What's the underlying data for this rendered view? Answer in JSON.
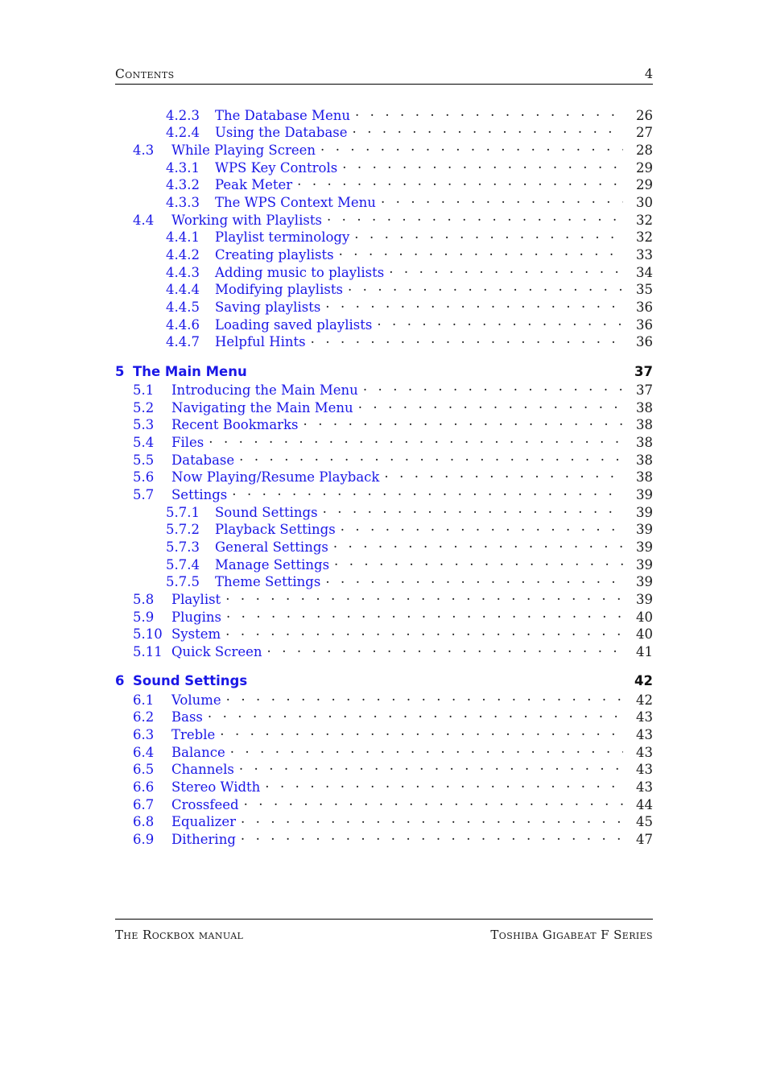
{
  "header": {
    "title": "Contents",
    "page_number": "4"
  },
  "footer": {
    "left": "The Rockbox manual",
    "right": "Toshiba Gigabeat F Series"
  },
  "colors": {
    "link": "#1a17e6",
    "text": "#1a1a1a",
    "leader": "#222222"
  },
  "toc": {
    "entries": [
      {
        "level": 3,
        "number": "4.2.3",
        "title": "The Database Menu",
        "page": "26"
      },
      {
        "level": 3,
        "number": "4.2.4",
        "title": "Using the Database",
        "page": "27"
      },
      {
        "level": 2,
        "number": "4.3",
        "title": "While Playing Screen",
        "page": "28"
      },
      {
        "level": 3,
        "number": "4.3.1",
        "title": "WPS Key Controls",
        "page": "29"
      },
      {
        "level": 3,
        "number": "4.3.2",
        "title": "Peak Meter",
        "page": "29"
      },
      {
        "level": 3,
        "number": "4.3.3",
        "title": "The WPS Context Menu",
        "page": "30"
      },
      {
        "level": 2,
        "number": "4.4",
        "title": "Working with Playlists",
        "page": "32"
      },
      {
        "level": 3,
        "number": "4.4.1",
        "title": "Playlist terminology",
        "page": "32"
      },
      {
        "level": 3,
        "number": "4.4.2",
        "title": "Creating playlists",
        "page": "33"
      },
      {
        "level": 3,
        "number": "4.4.3",
        "title": "Adding music to playlists",
        "page": "34"
      },
      {
        "level": 3,
        "number": "4.4.4",
        "title": "Modifying playlists",
        "page": "35"
      },
      {
        "level": 3,
        "number": "4.4.5",
        "title": "Saving playlists",
        "page": "36"
      },
      {
        "level": 3,
        "number": "4.4.6",
        "title": "Loading saved playlists",
        "page": "36"
      },
      {
        "level": 3,
        "number": "4.4.7",
        "title": "Helpful Hints",
        "page": "36"
      },
      {
        "level": 1,
        "number": "5",
        "title": "The Main Menu",
        "page": "37"
      },
      {
        "level": 2,
        "number": "5.1",
        "title": "Introducing the Main Menu",
        "page": "37"
      },
      {
        "level": 2,
        "number": "5.2",
        "title": "Navigating the Main Menu",
        "page": "38"
      },
      {
        "level": 2,
        "number": "5.3",
        "title": "Recent Bookmarks",
        "page": "38"
      },
      {
        "level": 2,
        "number": "5.4",
        "title": "Files",
        "page": "38"
      },
      {
        "level": 2,
        "number": "5.5",
        "title": "Database",
        "page": "38"
      },
      {
        "level": 2,
        "number": "5.6",
        "title": "Now Playing/Resume Playback",
        "page": "38"
      },
      {
        "level": 2,
        "number": "5.7",
        "title": "Settings",
        "page": "39"
      },
      {
        "level": 3,
        "number": "5.7.1",
        "title": "Sound Settings",
        "page": "39"
      },
      {
        "level": 3,
        "number": "5.7.2",
        "title": "Playback Settings",
        "page": "39"
      },
      {
        "level": 3,
        "number": "5.7.3",
        "title": "General Settings",
        "page": "39"
      },
      {
        "level": 3,
        "number": "5.7.4",
        "title": "Manage Settings",
        "page": "39"
      },
      {
        "level": 3,
        "number": "5.7.5",
        "title": "Theme Settings",
        "page": "39"
      },
      {
        "level": 2,
        "number": "5.8",
        "title": "Playlist",
        "page": "39"
      },
      {
        "level": 2,
        "number": "5.9",
        "title": "Plugins",
        "page": "40"
      },
      {
        "level": 2,
        "number": "5.10",
        "title": "System",
        "page": "40"
      },
      {
        "level": 2,
        "number": "5.11",
        "title": "Quick Screen",
        "page": "41"
      },
      {
        "level": 1,
        "number": "6",
        "title": "Sound Settings",
        "page": "42"
      },
      {
        "level": 2,
        "number": "6.1",
        "title": "Volume",
        "page": "42"
      },
      {
        "level": 2,
        "number": "6.2",
        "title": "Bass",
        "page": "43"
      },
      {
        "level": 2,
        "number": "6.3",
        "title": "Treble",
        "page": "43"
      },
      {
        "level": 2,
        "number": "6.4",
        "title": "Balance",
        "page": "43"
      },
      {
        "level": 2,
        "number": "6.5",
        "title": "Channels",
        "page": "43"
      },
      {
        "level": 2,
        "number": "6.6",
        "title": "Stereo Width",
        "page": "43"
      },
      {
        "level": 2,
        "number": "6.7",
        "title": "Crossfeed",
        "page": "44"
      },
      {
        "level": 2,
        "number": "6.8",
        "title": "Equalizer",
        "page": "45"
      },
      {
        "level": 2,
        "number": "6.9",
        "title": "Dithering",
        "page": "47"
      }
    ]
  }
}
